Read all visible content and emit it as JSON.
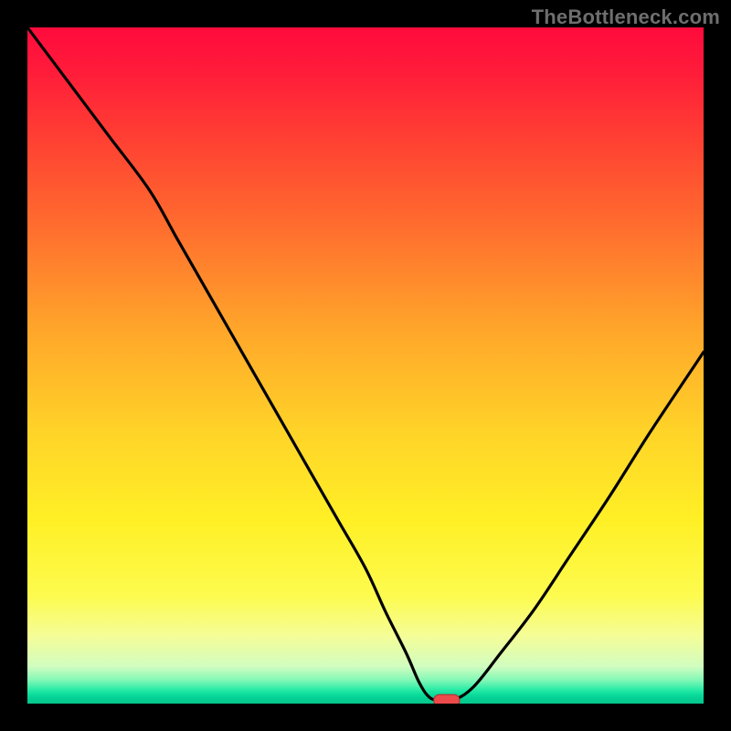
{
  "watermark": "TheBottleneck.com",
  "colors": {
    "background": "#000000",
    "curve": "#000000",
    "marker_fill": "#ed4b4b",
    "marker_stroke": "#b53131"
  },
  "chart_data": {
    "type": "line",
    "title": "",
    "xlabel": "",
    "ylabel": "",
    "xlim": [
      0,
      100
    ],
    "ylim": [
      0,
      100
    ],
    "grid": false,
    "background": "vertical-gradient (red→orange→yellow→green)",
    "series": [
      {
        "name": "bottleneck-curve",
        "x": [
          0,
          6,
          12,
          18,
          22,
          26,
          30,
          34,
          38,
          42,
          46,
          50,
          53,
          56,
          58,
          59.5,
          61,
          63,
          66,
          70,
          75,
          80,
          86,
          92,
          98,
          100
        ],
        "y": [
          100,
          92,
          84,
          76,
          69,
          62,
          55,
          48,
          41,
          34,
          27,
          20,
          13.5,
          7.5,
          3.0,
          0.9,
          0.5,
          0.5,
          2.5,
          7.5,
          14.0,
          21.5,
          30.5,
          40.0,
          49.0,
          52.0
        ]
      }
    ],
    "marker": {
      "x": 62,
      "y": 0.45,
      "shape": "rounded-rect"
    }
  }
}
